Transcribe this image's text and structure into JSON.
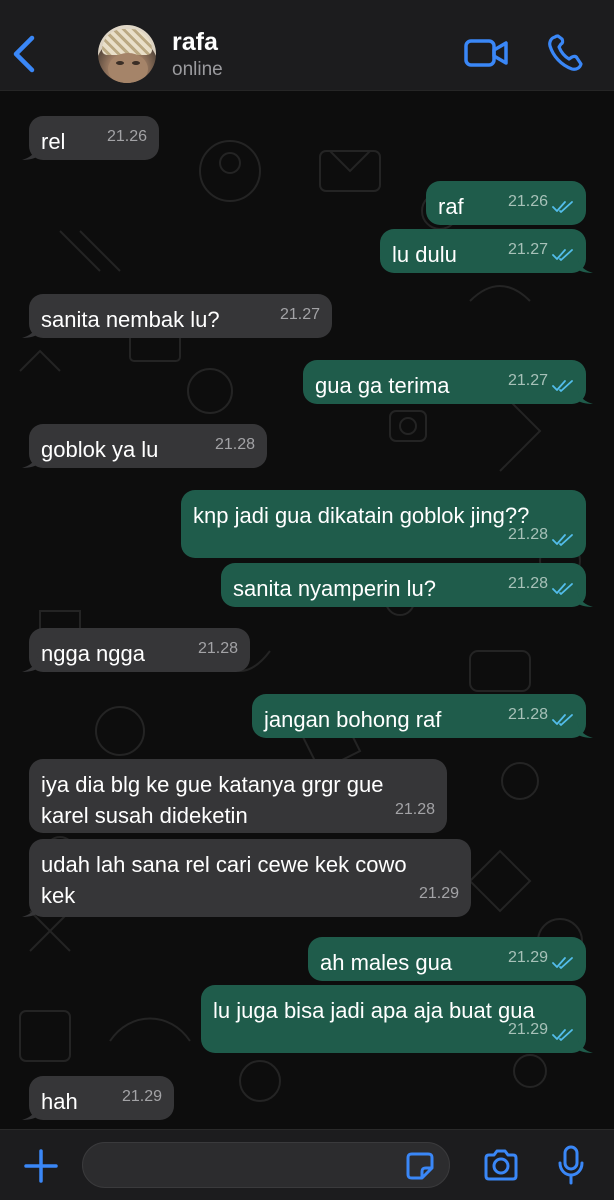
{
  "header": {
    "back_icon": "chevron-left-icon",
    "contact_name": "rafa",
    "contact_status": "online",
    "video_icon": "video-camera-icon",
    "call_icon": "phone-icon",
    "accent_color": "#3a87f7"
  },
  "messages": [
    {
      "direction": "in",
      "text": "rel",
      "time": "21.26"
    },
    {
      "direction": "out",
      "text": "raf",
      "time": "21.26",
      "read": true
    },
    {
      "direction": "out",
      "text": "lu dulu",
      "time": "21.27",
      "read": true
    },
    {
      "direction": "in",
      "text": "sanita nembak lu?",
      "time": "21.27"
    },
    {
      "direction": "out",
      "text": "gua ga terima",
      "time": "21.27",
      "read": true
    },
    {
      "direction": "in",
      "text": "goblok ya lu",
      "time": "21.28"
    },
    {
      "direction": "out",
      "text": "knp jadi gua dikatain goblok jing??",
      "time": "21.28",
      "read": true
    },
    {
      "direction": "out",
      "text": "sanita nyamperin lu?",
      "time": "21.28",
      "read": true
    },
    {
      "direction": "in",
      "text": "ngga ngga",
      "time": "21.28"
    },
    {
      "direction": "out",
      "text": "jangan bohong raf",
      "time": "21.28",
      "read": true
    },
    {
      "direction": "in",
      "text": "iya dia blg ke gue katanya grgr gue\nkarel susah dideketin",
      "time": "21.28"
    },
    {
      "direction": "in",
      "text": "udah lah sana rel cari cewe kek cowo\nkek",
      "time": "21.29"
    },
    {
      "direction": "out",
      "text": "ah males gua",
      "time": "21.29",
      "read": true
    },
    {
      "direction": "out",
      "text": "lu juga bisa jadi apa aja buat gua",
      "time": "21.29",
      "read": true
    },
    {
      "direction": "in",
      "text": "hah",
      "time": "21.29"
    }
  ],
  "composer": {
    "plus_icon": "plus-icon",
    "input_value": "",
    "sticker_icon": "sticker-icon",
    "camera_icon": "camera-icon",
    "mic_icon": "microphone-icon"
  },
  "colors": {
    "incoming_bubble": "#363638",
    "outgoing_bubble": "#1f5c4b",
    "read_ticks": "#53bdeb"
  }
}
